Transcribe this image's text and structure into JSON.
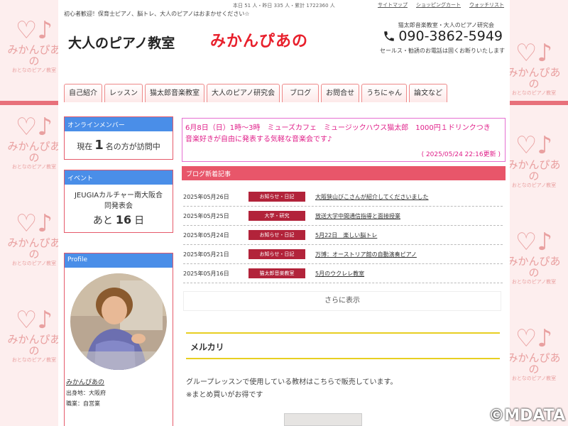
{
  "background_logo": {
    "text": "みかんぴあの",
    "sub": "おとなのピアノ教室"
  },
  "topbar": {
    "counts": "本日 51 人・昨日 335 人・累計 1722360 人",
    "links": [
      "サイトマップ",
      "ショッピングカート",
      "ウォッチリスト"
    ],
    "tagline": "初心者歓迎！保育士ピアノ、脳トレ、大人のピアノはおまかせください☆"
  },
  "header": {
    "title": "大人のピアノ教室",
    "logo": "みかんぴあの",
    "contact_sub": "猫太郎音楽教室・大人のピアノ研究会",
    "phone": "090-3862-5949",
    "phone_note": "セールス・勧誘のお電話は固くお断りいたします"
  },
  "nav": [
    "自己紹介",
    "レッスン",
    "猫太郎音楽教室",
    "大人のピアノ研究会",
    "ブログ",
    "お問合せ",
    "うちにゃん",
    "論文など"
  ],
  "sidebar": {
    "online": {
      "head": "オンラインメンバー",
      "prefix": "現在",
      "count": "1",
      "suffix": "名の方が訪問中"
    },
    "event": {
      "head": "イベント",
      "line1": "JEUGIAカルチャー南大阪合",
      "line2": "同発表会",
      "prefix": "あと",
      "count": "16",
      "suffix": "日"
    },
    "profile": {
      "head": "Profile",
      "name": "みかんぴあの",
      "origin": "出身地：大阪府",
      "job": "職業：自営業"
    }
  },
  "notice": {
    "text": "6月8日（日）1時〜3時　ミューズカフェ　ミュージックハウス猫太郎　1000円１ドリンクつき　音楽好きが自由に発表する気軽な音楽会です♪",
    "date": "( 2025/05/24 22:16更新 )"
  },
  "blog": {
    "head": "ブログ新着記事",
    "rows": [
      {
        "date": "2025年05月26日",
        "category": "お知らせ・日記",
        "title": "大阪狭山びこさんが紹介してくださいました"
      },
      {
        "date": "2025年05月25日",
        "category": "大学・研究",
        "title": "放送大学中間通信指導と面接授業"
      },
      {
        "date": "2025年05月24日",
        "category": "お知らせ・日記",
        "title": "5月22日　楽しい脳トレ"
      },
      {
        "date": "2025年05月21日",
        "category": "お知らせ・日記",
        "title": "万博：オーストリア館の自動演奏ピアノ"
      },
      {
        "date": "2025年05月16日",
        "category": "猫太郎音楽教室",
        "title": "5月のウクレレ教室"
      }
    ],
    "more": "さらに表示"
  },
  "section": {
    "title": "メルカリ",
    "line1": "グループレッスンで使用している教材はこちらで販売しています。",
    "line2": "※まとめ買いがお得です"
  },
  "watermark": "©MDATA"
}
